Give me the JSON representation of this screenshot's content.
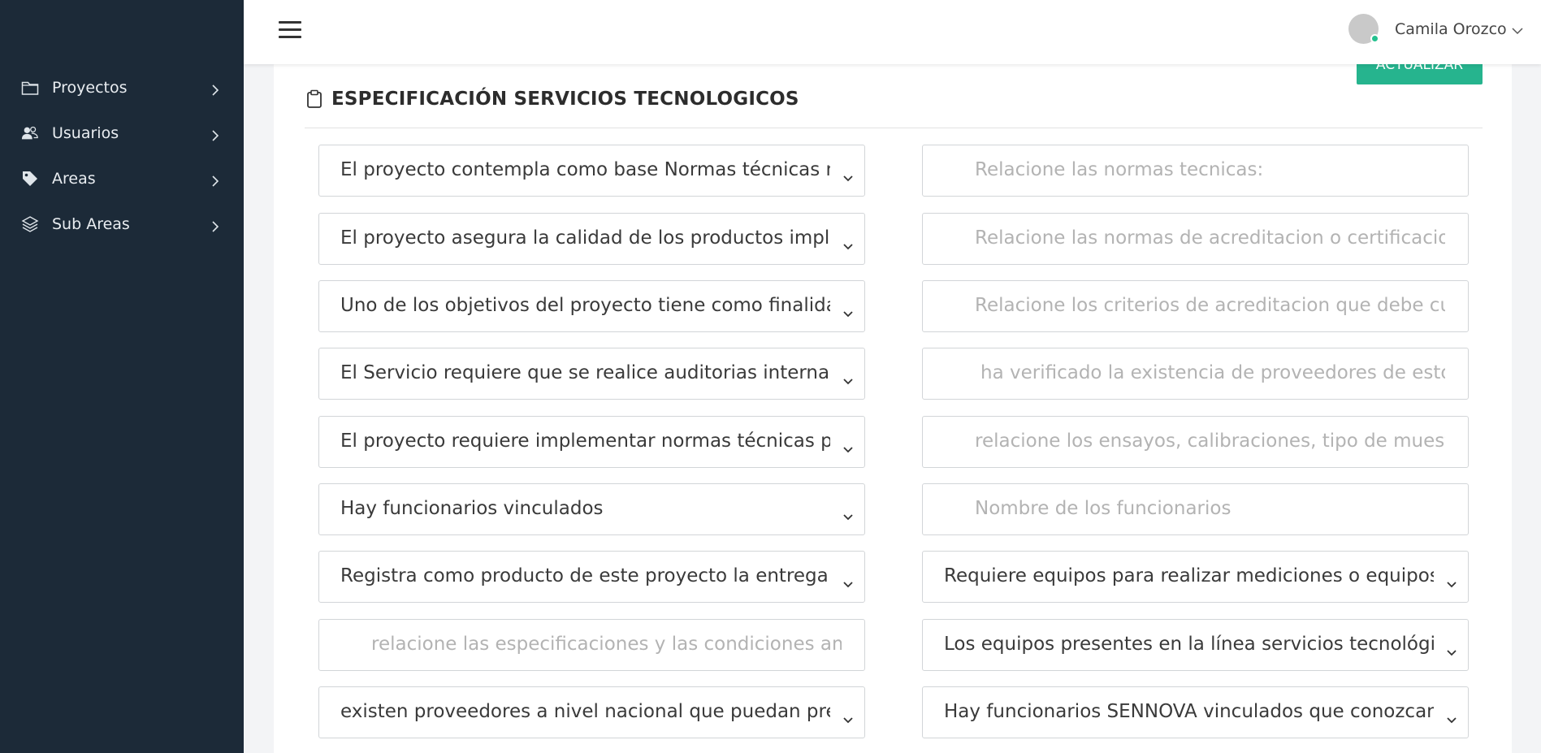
{
  "sidebar": {
    "items": [
      {
        "label": "Proyectos",
        "icon": "folder-icon"
      },
      {
        "label": "Usuarios",
        "icon": "users-icon"
      },
      {
        "label": "Areas",
        "icon": "tag-icon"
      },
      {
        "label": "Sub Areas",
        "icon": "layers-icon"
      }
    ]
  },
  "header": {
    "user_name": "Camila Orozco",
    "status_color": "#24c18f"
  },
  "card": {
    "title": "ESPECIFICACIÓN SERVICIOS TECNOLOGICOS",
    "update_label": "ACTUALIZAR",
    "accent_color": "#26b48e"
  },
  "form": {
    "rows": [
      {
        "left": {
          "type": "select",
          "value": "El proyecto contempla como base Normas técnicas nacionales"
        },
        "right": {
          "type": "input",
          "placeholder": "Relacione las normas tecnicas:"
        }
      },
      {
        "left": {
          "type": "select",
          "value": "El proyecto asegura la calidad de los productos implementando"
        },
        "right": {
          "type": "input",
          "placeholder": "Relacione las normas de acreditacion o certificacion"
        }
      },
      {
        "left": {
          "type": "select",
          "value": "Uno de los objetivos del proyecto tiene como finalidad"
        },
        "right": {
          "type": "input",
          "placeholder": "Relacione los criterios de acreditacion que debe cumplir"
        }
      },
      {
        "left": {
          "type": "select",
          "value": "El Servicio requiere que se realice auditorias internas, para"
        },
        "right": {
          "type": "input",
          "placeholder": "ha verificado la existencia de proveedores de estos servicios"
        }
      },
      {
        "left": {
          "type": "select",
          "value": "El proyecto requiere implementar normas técnicas para"
        },
        "right": {
          "type": "input",
          "placeholder": "relacione los ensayos, calibraciones, tipo de muestreo"
        }
      },
      {
        "left": {
          "type": "select",
          "value": "Hay funcionarios vinculados"
        },
        "right": {
          "type": "input",
          "placeholder": "Nombre de los funcionarios"
        }
      },
      {
        "left": {
          "type": "select",
          "value": "Registra como producto de este proyecto la entrega de"
        },
        "right": {
          "type": "select",
          "value": "Requiere equipos para realizar mediciones o equipos a"
        }
      },
      {
        "left": {
          "type": "input",
          "placeholder": "relacione las especificaciones y las condiciones ambientales"
        },
        "right": {
          "type": "select",
          "value": "Los equipos presentes en la línea servicios tecnológicos"
        }
      },
      {
        "left": {
          "type": "select",
          "value": "existen proveedores a nivel nacional que puedan prestar"
        },
        "right": {
          "type": "select",
          "value": "Hay funcionarios SENNOVA vinculados que conozcan su"
        }
      }
    ]
  }
}
